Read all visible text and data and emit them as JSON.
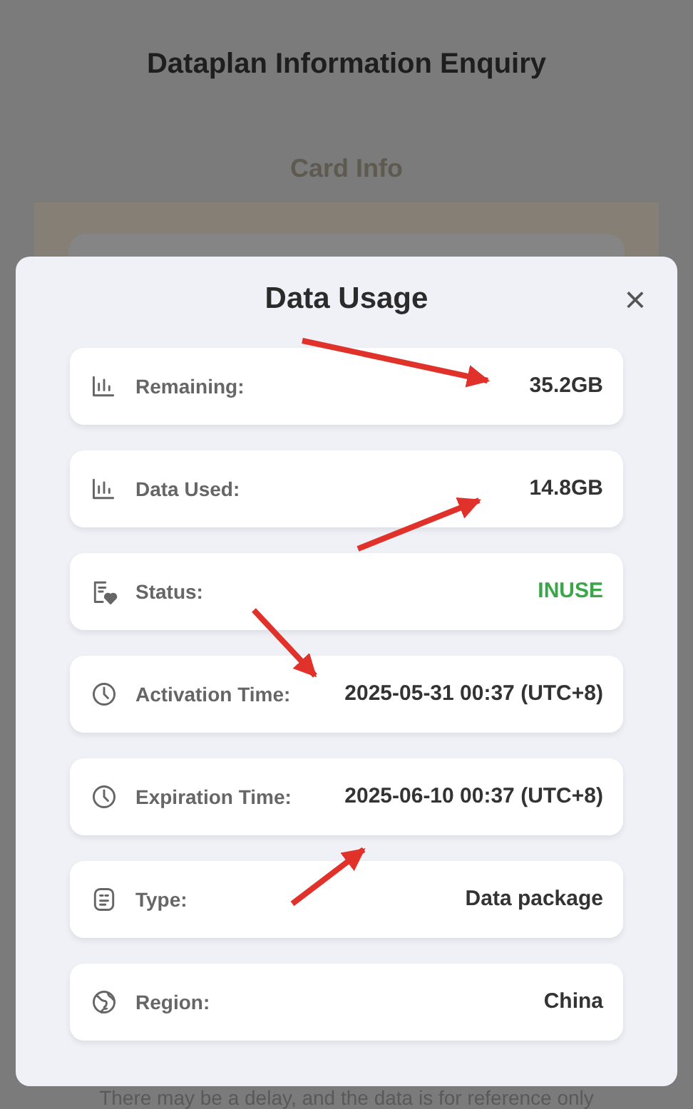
{
  "page": {
    "title": "Dataplan Information Enquiry",
    "section": "Card Info",
    "note": "There may be a delay, and the data is for reference only"
  },
  "dialog": {
    "title": "Data Usage",
    "close": "×",
    "rows": [
      {
        "kind": "bars",
        "label": "Remaining:",
        "value": "35.2GB"
      },
      {
        "kind": "bars",
        "label": "Data Used:",
        "value": "14.8GB"
      },
      {
        "kind": "status",
        "label": "Status:",
        "value": "INUSE",
        "color": "#3aa648"
      },
      {
        "kind": "clock",
        "label": "Activation Time:",
        "value": "2025-05-31 00:37 (UTC+8)"
      },
      {
        "kind": "clock",
        "label": "Expiration Time:",
        "value": "2025-06-10 00:37 (UTC+8)"
      },
      {
        "kind": "type",
        "label": "Type:",
        "value": "Data package"
      },
      {
        "kind": "globe",
        "label": "Region:",
        "value": "China"
      }
    ]
  }
}
